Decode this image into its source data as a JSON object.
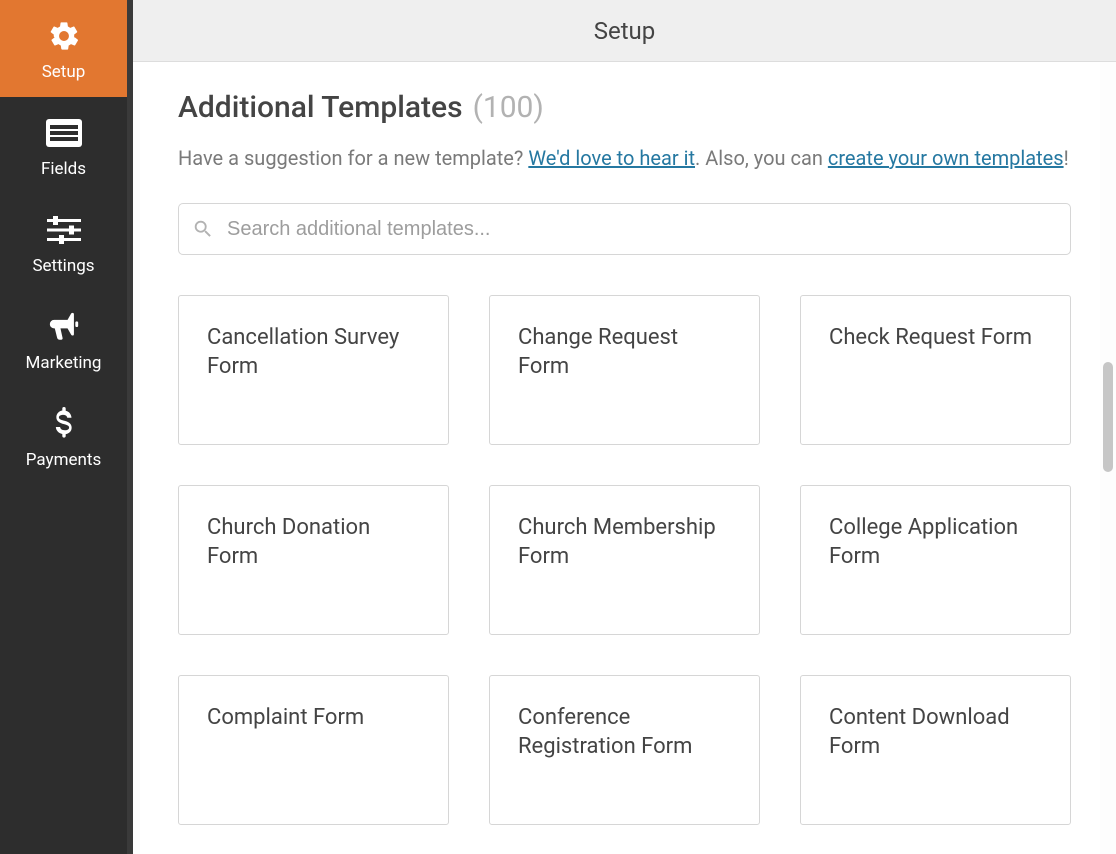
{
  "sidebar": {
    "items": [
      {
        "label": "Setup",
        "icon": "gear-icon",
        "active": true
      },
      {
        "label": "Fields",
        "icon": "list-icon",
        "active": false
      },
      {
        "label": "Settings",
        "icon": "sliders-icon",
        "active": false
      },
      {
        "label": "Marketing",
        "icon": "bullhorn-icon",
        "active": false
      },
      {
        "label": "Payments",
        "icon": "dollar-icon",
        "active": false
      }
    ]
  },
  "header": {
    "title": "Setup"
  },
  "section": {
    "title": "Additional Templates",
    "count": "(100)"
  },
  "subtext": {
    "part1": "Have a suggestion for a new template? ",
    "link1": "We'd love to hear it",
    "part2": ". Also, you can ",
    "link2": "create your own templates",
    "part3": "!"
  },
  "search": {
    "placeholder": "Search additional templates..."
  },
  "templates": [
    "Cancellation Survey Form",
    "Change Request Form",
    "Check Request Form",
    "Church Donation Form",
    "Church Membership Form",
    "College Application Form",
    "Complaint Form",
    "Conference Registration Form",
    "Content Download Form"
  ]
}
